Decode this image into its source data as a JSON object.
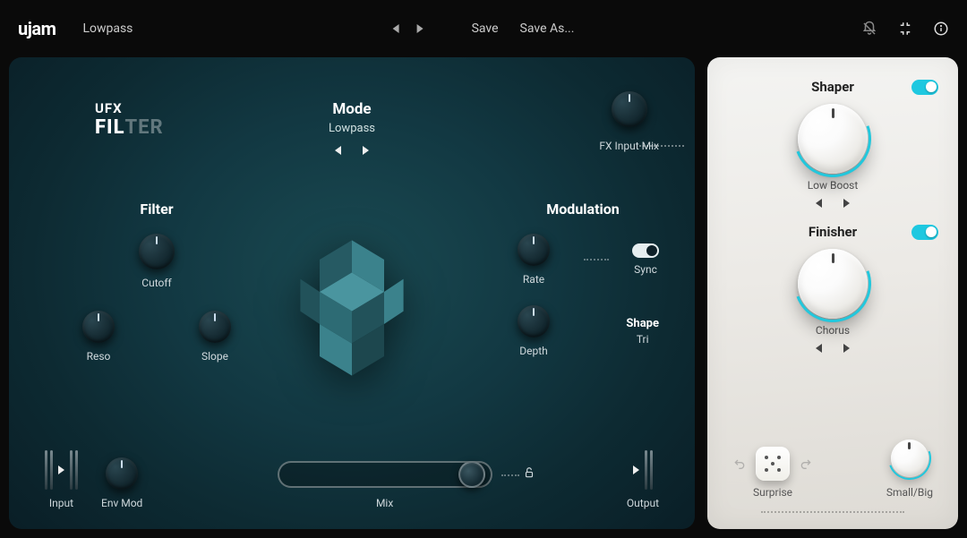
{
  "brand": "ujam",
  "preset": "Lowpass",
  "topbar": {
    "save": "Save",
    "save_as": "Save As..."
  },
  "logo": {
    "prefix": "UFX",
    "name_a": "FIL",
    "name_b": "TER"
  },
  "mode": {
    "title": "Mode",
    "value": "Lowpass"
  },
  "fx_input": {
    "label": "FX Input Mix"
  },
  "filter": {
    "title": "Filter",
    "cutoff": "Cutoff",
    "reso": "Reso",
    "slope": "Slope"
  },
  "modulation": {
    "title": "Modulation",
    "rate": "Rate",
    "sync": "Sync",
    "depth": "Depth",
    "shape_title": "Shape",
    "shape_value": "Tri"
  },
  "bottom": {
    "input": "Input",
    "env_mod": "Env Mod",
    "mix": "Mix",
    "output": "Output"
  },
  "side": {
    "shaper": {
      "title": "Shaper",
      "value": "Low Boost",
      "enabled": true
    },
    "finisher": {
      "title": "Finisher",
      "value": "Chorus",
      "enabled": true
    },
    "surprise": "Surprise",
    "smallbig": "Small/Big"
  },
  "icons": {
    "bell": "bell-off-icon",
    "collapse": "collapse-icon",
    "info": "info-icon",
    "lock": "unlock-icon",
    "undo": "undo-icon",
    "redo": "redo-icon",
    "dice": "dice-icon"
  }
}
